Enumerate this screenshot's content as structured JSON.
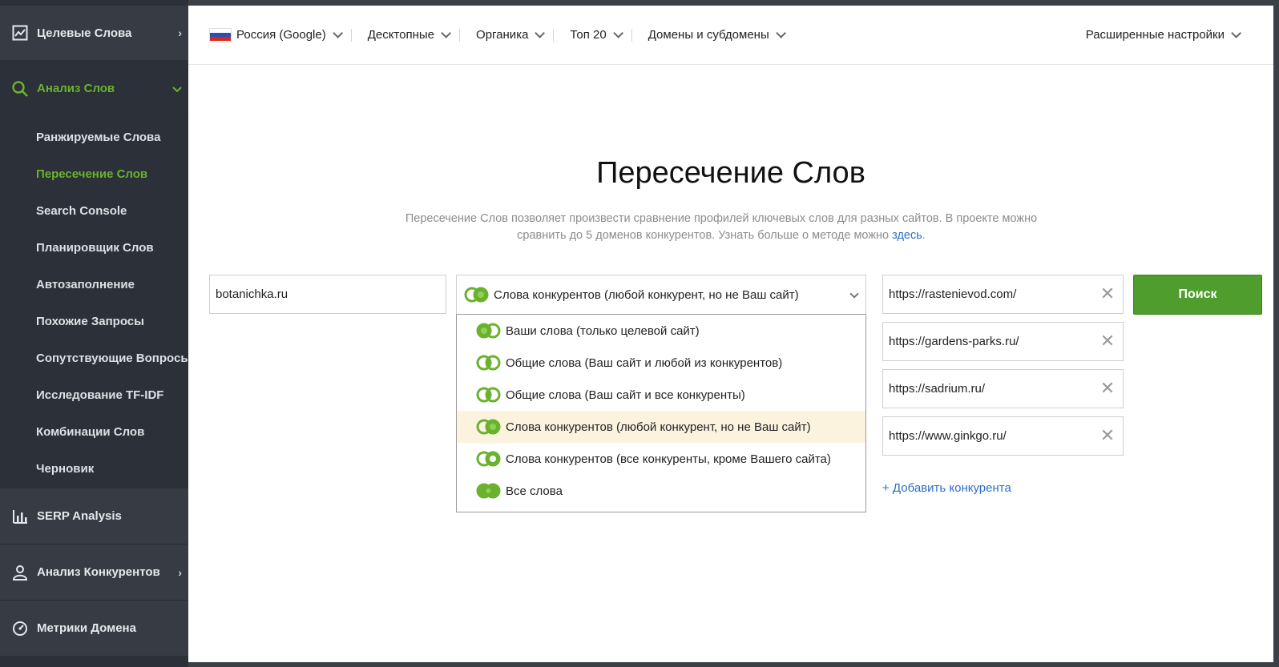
{
  "sidebar": {
    "sections": [
      {
        "label": "Целевые Слова",
        "icon": "trend-chart-icon"
      },
      {
        "label": "Анализ Слов",
        "icon": "search-icon"
      },
      {
        "label": "SERP Analysis",
        "icon": "bar-chart-icon"
      },
      {
        "label": "Анализ Конкурентов",
        "icon": "user-icon"
      },
      {
        "label": "Метрики Домена",
        "icon": "gauge-icon"
      }
    ],
    "sub_items": [
      "Ранжируемые Слова",
      "Пересечение Слов",
      "Search Console",
      "Планировщик Слов",
      "Автозаполнение",
      "Похожие Запросы",
      "Сопутствующие Вопросы",
      "Исследование TF-IDF",
      "Комбинации Слов",
      "Черновик"
    ],
    "active_sub_index": 1,
    "accent_color": "#6ab22e"
  },
  "topbar": {
    "country": "Россия (Google)",
    "device": "Десктопные",
    "search_type": "Органика",
    "top": "Топ 20",
    "domains": "Домены и субдомены",
    "advanced": "Расширенные настройки"
  },
  "main": {
    "title": "Пересечение Слов",
    "description": "Пересечение Слов позволяет произвести сравнение профилей ключевых слов для разных сайтов. В проекте можно сравнить до 5 доменов конкурентов. Узнать больше о методе можно ",
    "description_link": "здесь",
    "description_end": ".",
    "domain_value": "botanichka.ru",
    "selected_mode": "Слова конкурентов (любой конкурент, но не Ваш сайт)",
    "dropdown_options": [
      "Ваши слова (только целевой сайт)",
      "Общие слова (Ваш сайт и любой из конкурентов)",
      "Общие слова (Ваш сайт и все конкуренты)",
      "Слова конкурентов (любой конкурент, но не Ваш сайт)",
      "Слова конкурентов (все конкуренты, кроме Вашего сайта)",
      "Все слова"
    ],
    "highlighted_option_index": 3,
    "competitors": [
      "https://rastenievod.com/",
      "https://gardens-parks.ru/",
      "https://sadrium.ru/",
      "https://www.ginkgo.ru/"
    ],
    "add_competitor": "+ Добавить конкурента",
    "search_button": "Поиск",
    "button_color": "#4f9d2d",
    "link_color": "#2d6ec8"
  }
}
